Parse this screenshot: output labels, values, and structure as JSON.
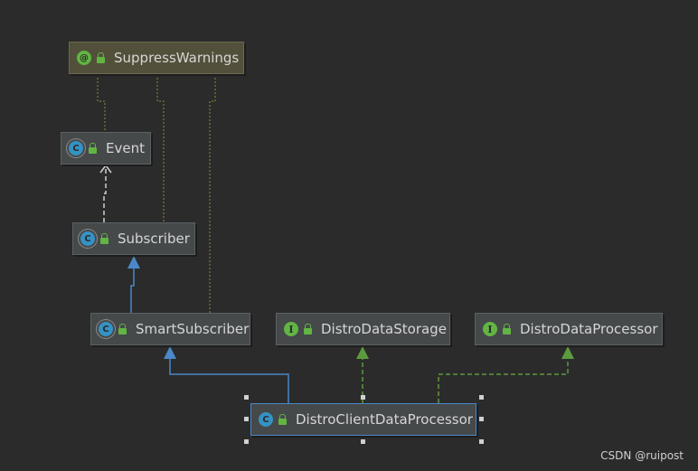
{
  "nodes": {
    "suppress_warnings": {
      "label": "SuppressWarnings",
      "icon": "@"
    },
    "event": {
      "label": "Event",
      "icon": "C"
    },
    "subscriber": {
      "label": "Subscriber",
      "icon": "C"
    },
    "smart_subscriber": {
      "label": "SmartSubscriber",
      "icon": "C"
    },
    "distro_data_storage": {
      "label": "DistroDataStorage",
      "icon": "I"
    },
    "distro_data_processor": {
      "label": "DistroDataProcessor",
      "icon": "I"
    },
    "distro_client_data_processor": {
      "label": "DistroClientDataProcessor",
      "icon": "C"
    }
  },
  "colors": {
    "background": "#2b2b2b",
    "extends_arrow": "#4a88c7",
    "implements_arrow": "#5c9a3e",
    "dependency": "#d0d0d0",
    "annotation_link": "#8c8c3c"
  },
  "watermark": "CSDN @ruipost"
}
